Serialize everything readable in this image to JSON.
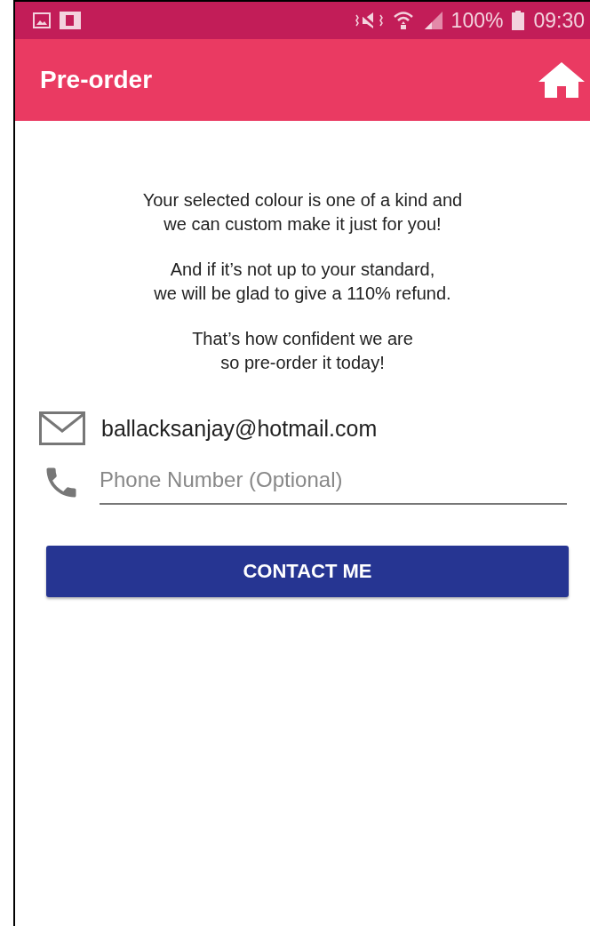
{
  "status_bar": {
    "battery_text": "100%",
    "time": "09:30"
  },
  "app_bar": {
    "title": "Pre-order"
  },
  "paragraphs": [
    {
      "lines": [
        "Your selected colour is one of a kind and",
        "we can custom make it just for you!"
      ]
    },
    {
      "lines": [
        "And if it’s not up to your standard,",
        "we will be glad to give a 110% refund."
      ]
    },
    {
      "lines": [
        "That’s how confident we are",
        "so pre-order it today!"
      ]
    }
  ],
  "email": {
    "value": "ballacksanjay@hotmail.com"
  },
  "phone": {
    "placeholder": "Phone Number (Optional)"
  },
  "button": {
    "label": "CONTACT ME"
  }
}
